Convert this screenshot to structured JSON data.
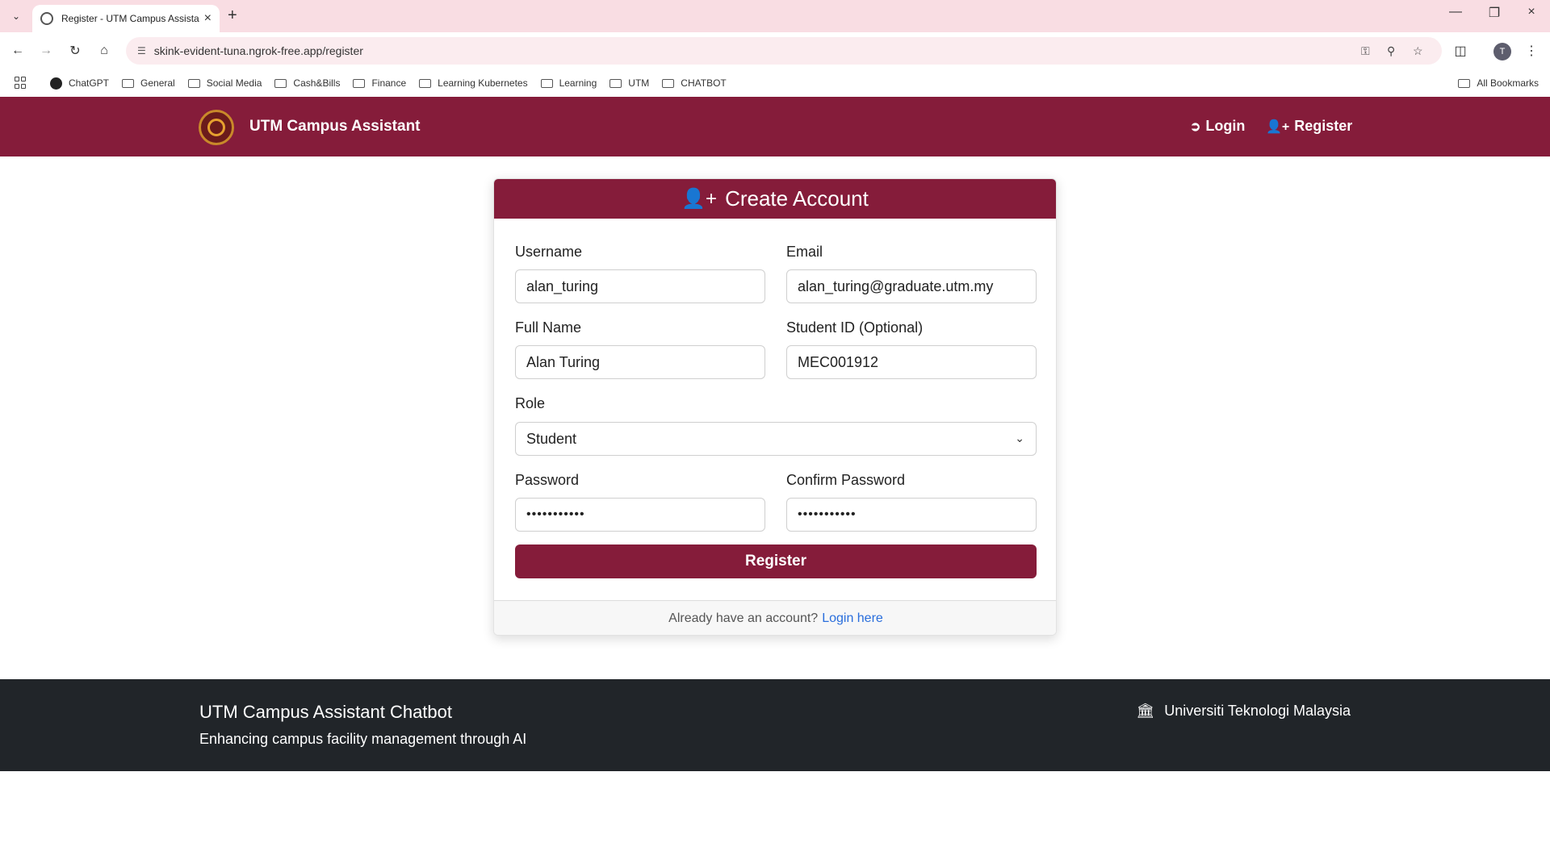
{
  "browser": {
    "tab_title": "Register - UTM Campus Assista",
    "url": "skink-evident-tuna.ngrok-free.app/register",
    "profile_initial": "T",
    "bookmarks": [
      "ChatGPT",
      "General",
      "Social Media",
      "Cash&Bills",
      "Finance",
      "Learning Kubernetes",
      "Learning",
      "UTM",
      "CHATBOT"
    ],
    "all_bookmarks": "All Bookmarks"
  },
  "header": {
    "brand": "UTM Campus Assistant",
    "login": "Login",
    "register": "Register"
  },
  "form": {
    "title": "Create Account",
    "username_label": "Username",
    "username_value": "alan_turing",
    "email_label": "Email",
    "email_value": "alan_turing@graduate.utm.my",
    "fullname_label": "Full Name",
    "fullname_value": "Alan Turing",
    "studentid_label": "Student ID (Optional)",
    "studentid_value": "MEC001912",
    "role_label": "Role",
    "role_value": "Student",
    "password_label": "Password",
    "password_value": "•••••••••••",
    "confirm_label": "Confirm Password",
    "confirm_value": "•••••••••••",
    "submit": "Register",
    "footer_text": "Already have an account?",
    "footer_link": "Login here"
  },
  "footer": {
    "title": "UTM Campus Assistant Chatbot",
    "subtitle": "Enhancing campus facility management through AI",
    "university": "Universiti Teknologi Malaysia"
  },
  "colors": {
    "brand": "#851c3a",
    "footer_bg": "#212529",
    "link": "#2a6edc"
  }
}
